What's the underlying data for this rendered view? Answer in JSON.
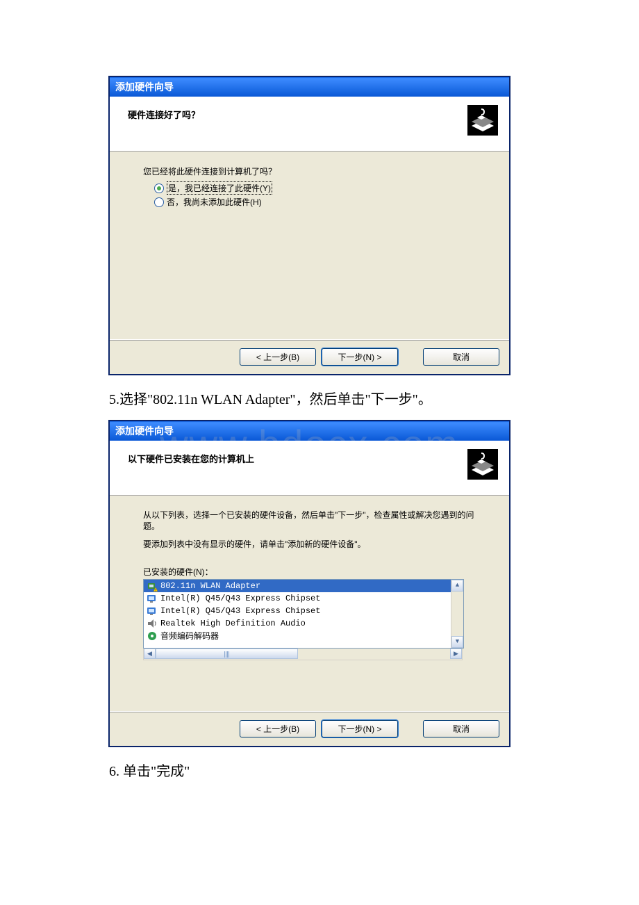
{
  "watermark": "www.bdocx.com",
  "dialog1": {
    "title": "添加硬件向导",
    "header": "硬件连接好了吗？",
    "prompt": "您已经将此硬件连接到计算机了吗？",
    "radio_yes": "是，我已经连接了此硬件(Y)",
    "radio_no": "否，我尚未添加此硬件(H)",
    "buttons": {
      "back": "< 上一步(B)",
      "next": "下一步(N) >",
      "cancel": "取消"
    }
  },
  "instruction5": "5.选择\"802.11n WLAN Adapter\"，然后单击\"下一步\"。",
  "dialog2": {
    "title": "添加硬件向导",
    "header": "以下硬件已安装在您的计算机上",
    "desc1": "从以下列表，选择一个已安装的硬件设备，然后单击\"下一步\"，检查属性或解决您遇到的问题。",
    "desc2": "要添加列表中没有显示的硬件，请单击\"添加新的硬件设备\"。",
    "list_label": "已安装的硬件(N)：",
    "items": [
      "802.11n WLAN Adapter",
      "Intel(R) Q45/Q43 Express Chipset",
      "Intel(R) Q45/Q43 Express Chipset",
      "Realtek High Definition Audio",
      "音频编码解码器"
    ],
    "buttons": {
      "back": "< 上一步(B)",
      "next": "下一步(N) >",
      "cancel": "取消"
    }
  },
  "instruction6": "6. 单击\"完成\""
}
